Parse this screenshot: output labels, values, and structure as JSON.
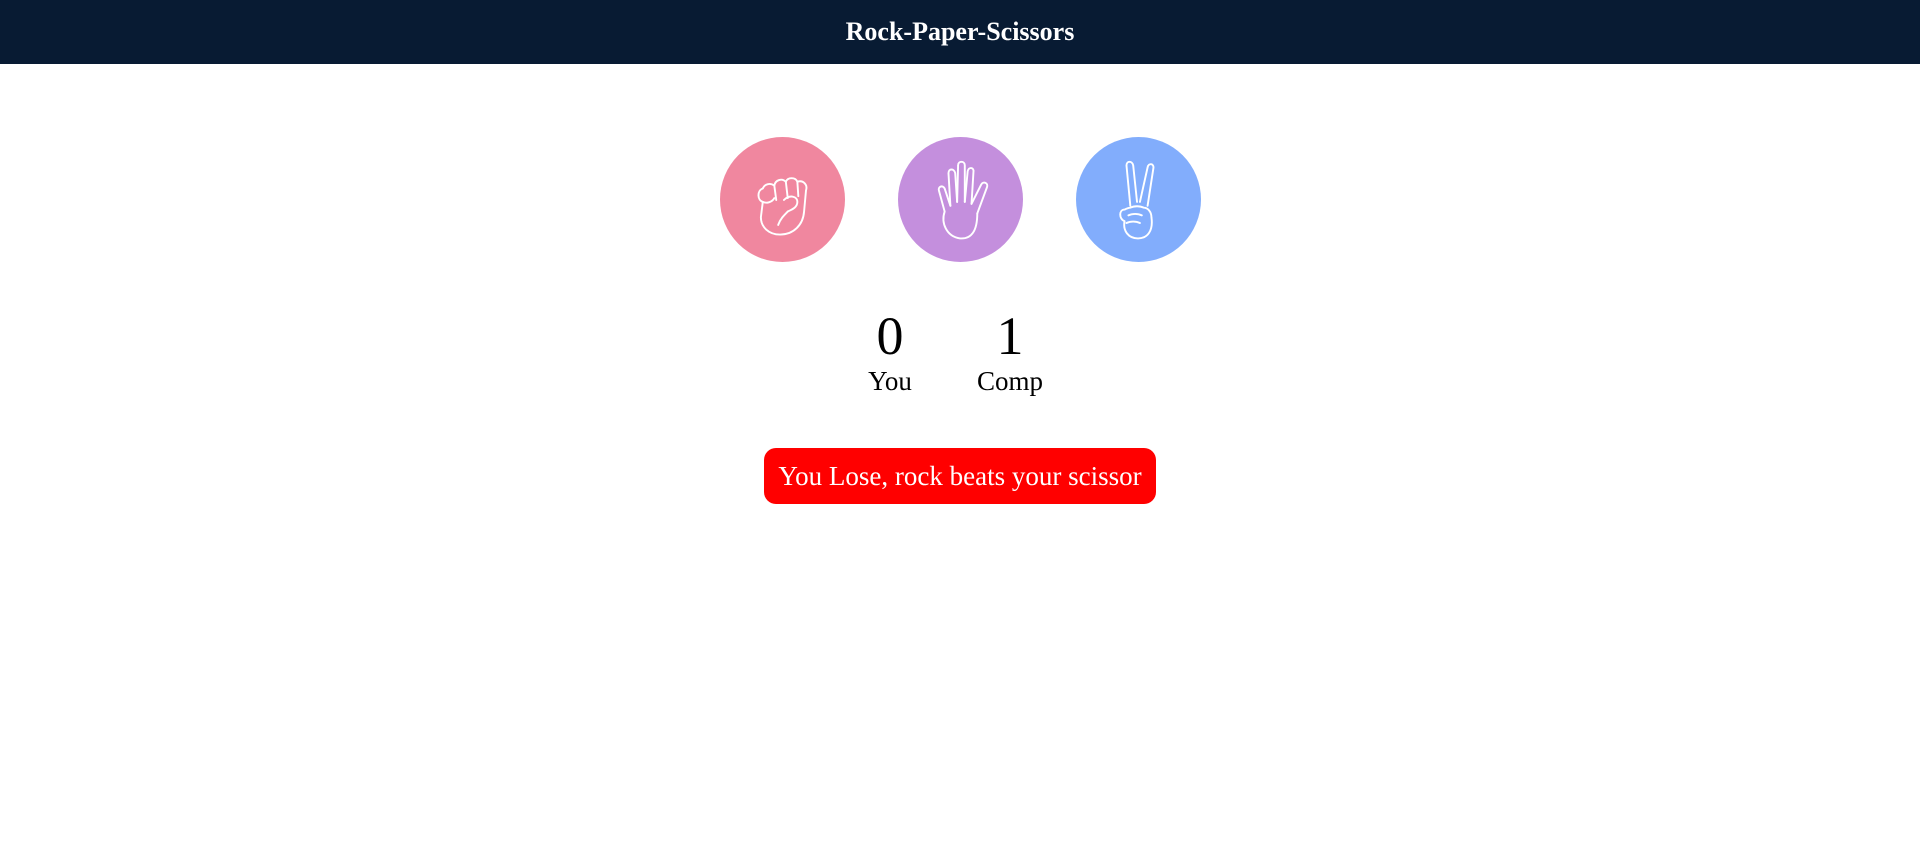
{
  "header": {
    "title": "Rock-Paper-Scissors"
  },
  "choices": [
    {
      "id": "rock",
      "icon": "fist-icon",
      "color": "#f0879f"
    },
    {
      "id": "paper",
      "icon": "open-hand-icon",
      "color": "#c48fdd"
    },
    {
      "id": "scissors",
      "icon": "peace-sign-icon",
      "color": "#82adfc"
    }
  ],
  "scores": {
    "user": {
      "value": "0",
      "label": "You"
    },
    "comp": {
      "value": "1",
      "label": "Comp"
    }
  },
  "message": {
    "text": "You Lose, rock beats your scissor",
    "color": "#ff0000"
  }
}
